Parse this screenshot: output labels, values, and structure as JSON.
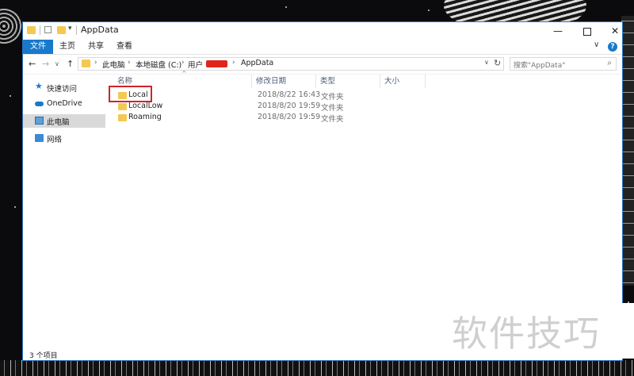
{
  "window": {
    "title": "AppData",
    "controls": {
      "minimize": "—",
      "close": "✕"
    }
  },
  "ribbon": {
    "tabs": [
      "文件",
      "主页",
      "共享",
      "查看"
    ],
    "chevron": "∨",
    "help": "?"
  },
  "nav": {
    "back": "←",
    "forward": "→",
    "recent": "∨",
    "up": "↑"
  },
  "address": {
    "crumbs": [
      "此电脑",
      "本地磁盘 (C:)",
      "用户",
      "AppData"
    ],
    "separator": "›",
    "dropdown": "∨",
    "refresh": "↻"
  },
  "search": {
    "placeholder": "搜索\"AppData\"",
    "icon": "⌕"
  },
  "sidebar": {
    "items": [
      {
        "label": "快速访问",
        "icon": "star-icon"
      },
      {
        "label": "OneDrive",
        "icon": "cloud-icon"
      },
      {
        "label": "此电脑",
        "icon": "computer-icon",
        "selected": true
      },
      {
        "label": "网络",
        "icon": "network-icon"
      }
    ]
  },
  "table": {
    "columns": [
      "名称",
      "修改日期",
      "类型",
      "大小"
    ],
    "sort_indicator": "^",
    "rows": [
      {
        "name": "Local",
        "date": "2018/8/22 16:43",
        "type": "文件夹"
      },
      {
        "name": "LocalLow",
        "date": "2018/8/20 19:59",
        "type": "文件夹"
      },
      {
        "name": "Roaming",
        "date": "2018/8/20 19:59",
        "type": "文件夹"
      }
    ]
  },
  "status": {
    "count": "3 个项目"
  },
  "watermark": "软件技巧",
  "colors": {
    "accent": "#1979ca",
    "folder": "#f4c952",
    "highlight": "#d0232a"
  }
}
